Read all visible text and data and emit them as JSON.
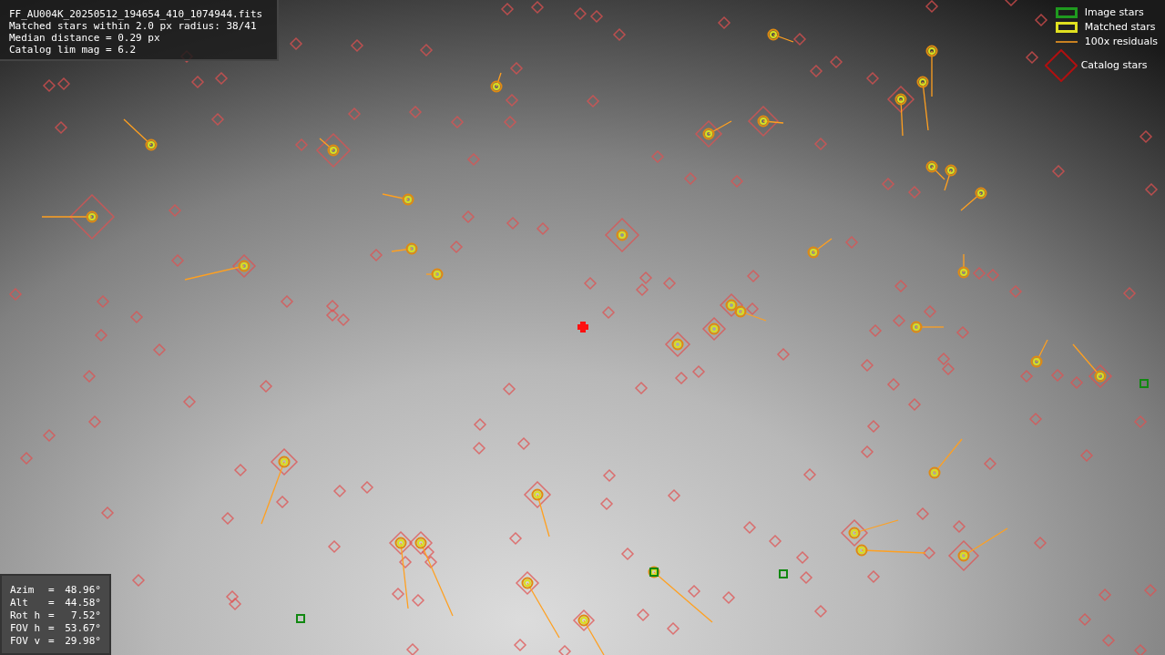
{
  "file_info": {
    "lines": [
      "FF_AU004K_20250512_194654_410_1074944.fits",
      "Matched stars within 2.0 px radius: 38/41",
      "Median distance = 0.29 px",
      "Catalog lim mag = 6.2"
    ]
  },
  "legend": [
    {
      "kind": "image",
      "label": "Image stars"
    },
    {
      "kind": "matched",
      "label": "Matched stars"
    },
    {
      "kind": "residual",
      "label": "100x residuals"
    },
    {
      "kind": "catalog",
      "label": "Catalog stars"
    }
  ],
  "pointing": [
    {
      "label": "Azim",
      "sep": "=",
      "value": "48.96°"
    },
    {
      "label": "Alt",
      "sep": "=",
      "value": "44.58°"
    },
    {
      "label": "Rot h",
      "sep": "=",
      "value": "7.52°"
    },
    {
      "label": "FOV h",
      "sep": "=",
      "value": "53.67°"
    },
    {
      "label": "FOV v",
      "sep": "=",
      "value": "29.98°"
    }
  ]
}
